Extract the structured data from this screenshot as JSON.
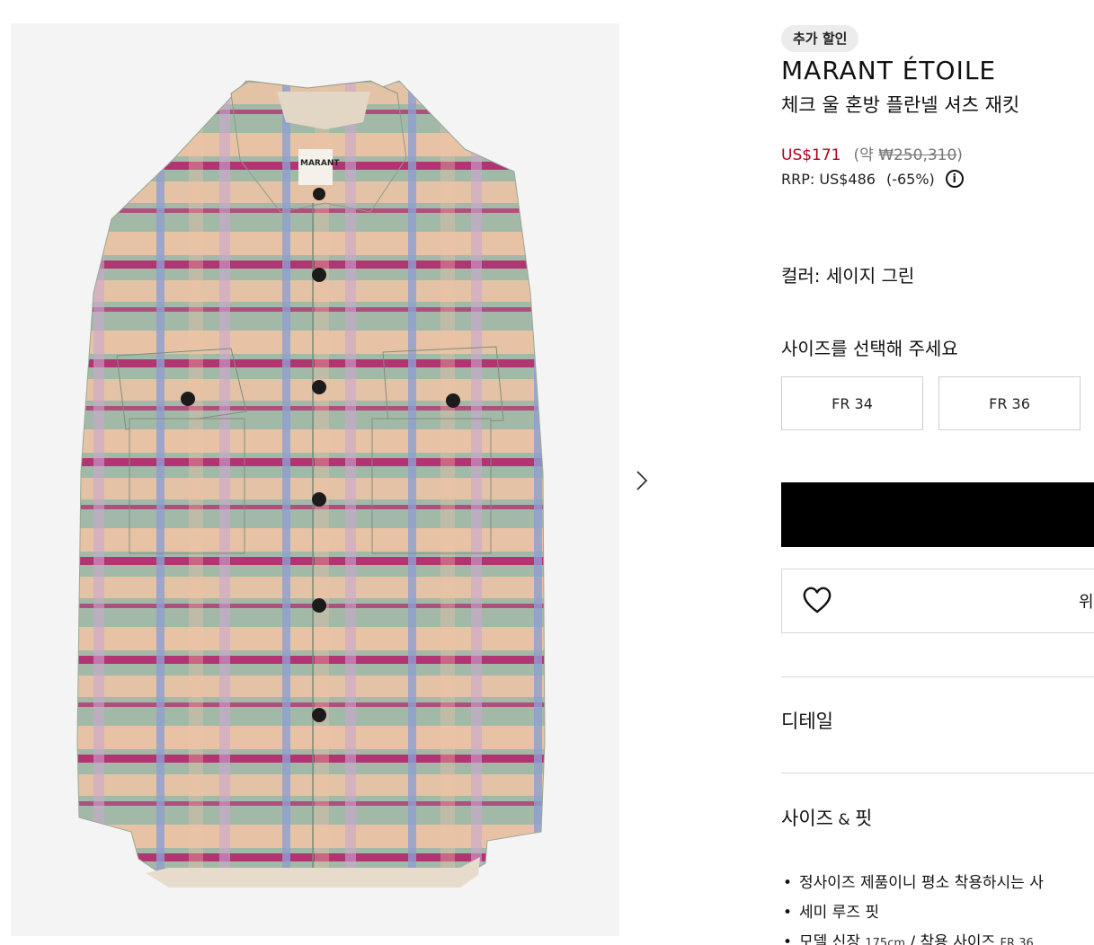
{
  "gallery": {
    "image_alt": "MARANT ÉTOILE 체크 울 혼방 플란넬 셔츠 재킷",
    "label_text": "MARANT"
  },
  "icons": {
    "next": "chevron-right-icon",
    "info": "info-circle-icon",
    "wishlist": "heart-icon"
  },
  "product": {
    "badge": "추가 할인",
    "brand": "MARANT ÉTOILE",
    "name": "체크 울 혼방 플란넬 셔츠 재킷",
    "price": "US$171",
    "approx_open": "(약 ",
    "approx_value": "₩250,310",
    "approx_close": ")",
    "rrp": "RRP: US$486",
    "discount": "(-65%)",
    "info_glyph": "i",
    "color_label": "컬러:",
    "color_value": "세이지 그린",
    "size_prompt": "사이즈를 선택해 주세요",
    "sizes": [
      "FR 34",
      "FR 36"
    ],
    "add_to_bag": "",
    "wishlist_label": "위"
  },
  "sections": {
    "details": "디테일",
    "size_fit_a": "사이즈",
    "size_fit_amp": " & ",
    "size_fit_b": "핏"
  },
  "size_notes": [
    "정사이즈 제품이니 평소 착용하시는 사",
    "세미 루즈 핏"
  ],
  "model_note": {
    "label": "모델 신장 ",
    "height": "175cm",
    "sep": " / 착용 사이즈 ",
    "size": "FR 36"
  },
  "colors": {
    "sale_price": "#b3001b",
    "sage": "#9fb8a6",
    "peach": "#f0c4a6",
    "magenta": "#b0326e",
    "lavender": "#a7a8d6"
  }
}
